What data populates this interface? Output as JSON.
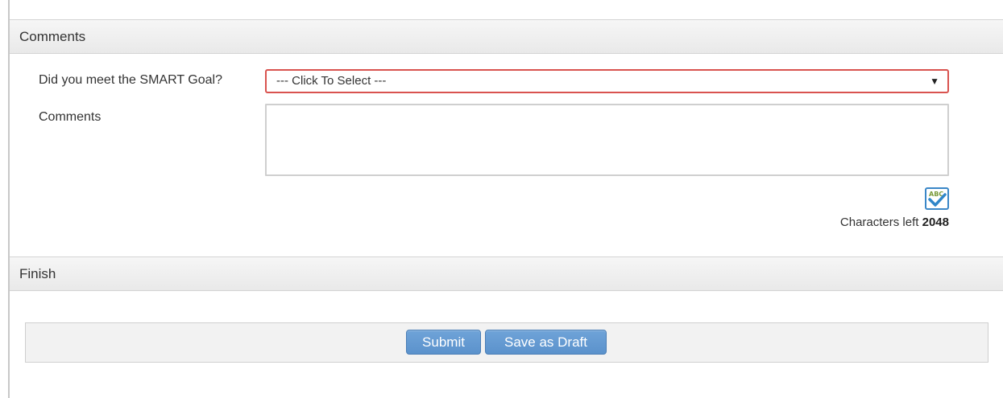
{
  "sections": {
    "comments_title": "Comments",
    "finish_title": "Finish"
  },
  "form": {
    "smart_goal_label": "Did you meet the SMART Goal?",
    "smart_goal_select_value": "--- Click To Select ---",
    "select_arrow": "▼",
    "comments_label": "Comments",
    "comments_value": "",
    "spellcheck_icon": "spellcheck-abc-icon",
    "characters_left_label": "Characters left",
    "characters_left_value": "2048"
  },
  "actions": {
    "submit_label": "Submit",
    "save_draft_label": "Save as Draft"
  },
  "colors": {
    "select_border_error": "#d9534f",
    "button_blue": "#5b92cc",
    "header_bg": "#eeeeee"
  }
}
